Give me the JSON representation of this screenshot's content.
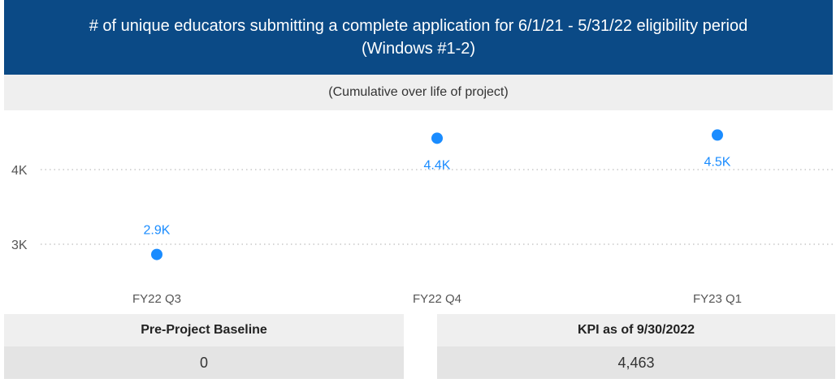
{
  "header": {
    "title": "# of unique educators submitting a complete application for 6/1/21 - 5/31/22 eligibility period (Windows #1-2)",
    "subtitle": "(Cumulative over life of project)"
  },
  "chart_data": {
    "type": "scatter",
    "categories": [
      "FY22 Q3",
      "FY22 Q4",
      "FY23 Q1"
    ],
    "values": [
      2863,
      4420,
      4463
    ],
    "data_labels": [
      "2.9K",
      "4.4K",
      "4.5K"
    ],
    "y_ticks": [
      {
        "value": 3000,
        "label": "3K"
      },
      {
        "value": 4000,
        "label": "4K"
      }
    ],
    "ylim": [
      2500,
      4700
    ],
    "grid": true,
    "marker_color": "#1a8cff",
    "label_color": "#1a8cff"
  },
  "cards": [
    {
      "title": "Pre-Project Baseline",
      "value": "0"
    },
    {
      "title": "KPI as of 9/30/2022",
      "value": "4,463"
    }
  ]
}
